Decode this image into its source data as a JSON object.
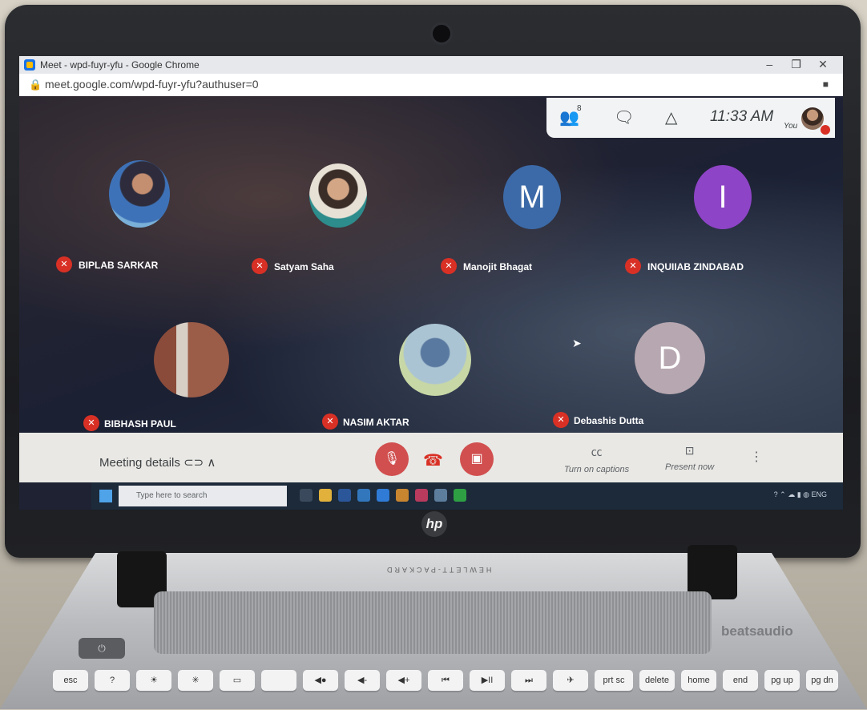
{
  "browser": {
    "tab_title": "Meet - wpd-fuyr-yfu - Google Chrome",
    "url": "meet.google.com/wpd-fuyr-yfu?authuser=0",
    "window_controls": [
      "–",
      "❐",
      "✕"
    ]
  },
  "meet_topbar": {
    "participants_count": "8",
    "time": "11:33 AM",
    "self_label": "You"
  },
  "participants": [
    {
      "name": "BIPLAB SARKAR",
      "avatar": "photo"
    },
    {
      "name": "Satyam Saha",
      "avatar": "photo"
    },
    {
      "name": "Manojit Bhagat",
      "avatar": "M",
      "color": "#3c6aa8"
    },
    {
      "name": "INQUIIAB ZINDABAD",
      "avatar": "I",
      "color": "#8e44c7"
    },
    {
      "name": "BIBHASH PAUL",
      "avatar": "photo"
    },
    {
      "name": "NASIM AKTAR",
      "avatar": "photo"
    },
    {
      "name": "Debashis Dutta",
      "avatar": "D",
      "color": "#b7a7b0"
    }
  ],
  "bottombar": {
    "meeting_details": "Meeting details",
    "captions": "Turn on captions",
    "present": "Present now"
  },
  "taskbar": {
    "search_placeholder": "Type here to search"
  },
  "laptop": {
    "brand_logo": "hp",
    "speaker_brand": "beatsaudio",
    "hinge_text": "HEWLETT-PACKARD",
    "keys": [
      "esc",
      "?",
      "☀",
      "✳",
      "▭",
      "",
      "◀●",
      "◀-",
      "◀+",
      "⏮",
      "▶II",
      "⏭",
      "✈",
      "prt sc",
      "delete",
      "home",
      "end",
      "pg up",
      "pg dn"
    ]
  }
}
